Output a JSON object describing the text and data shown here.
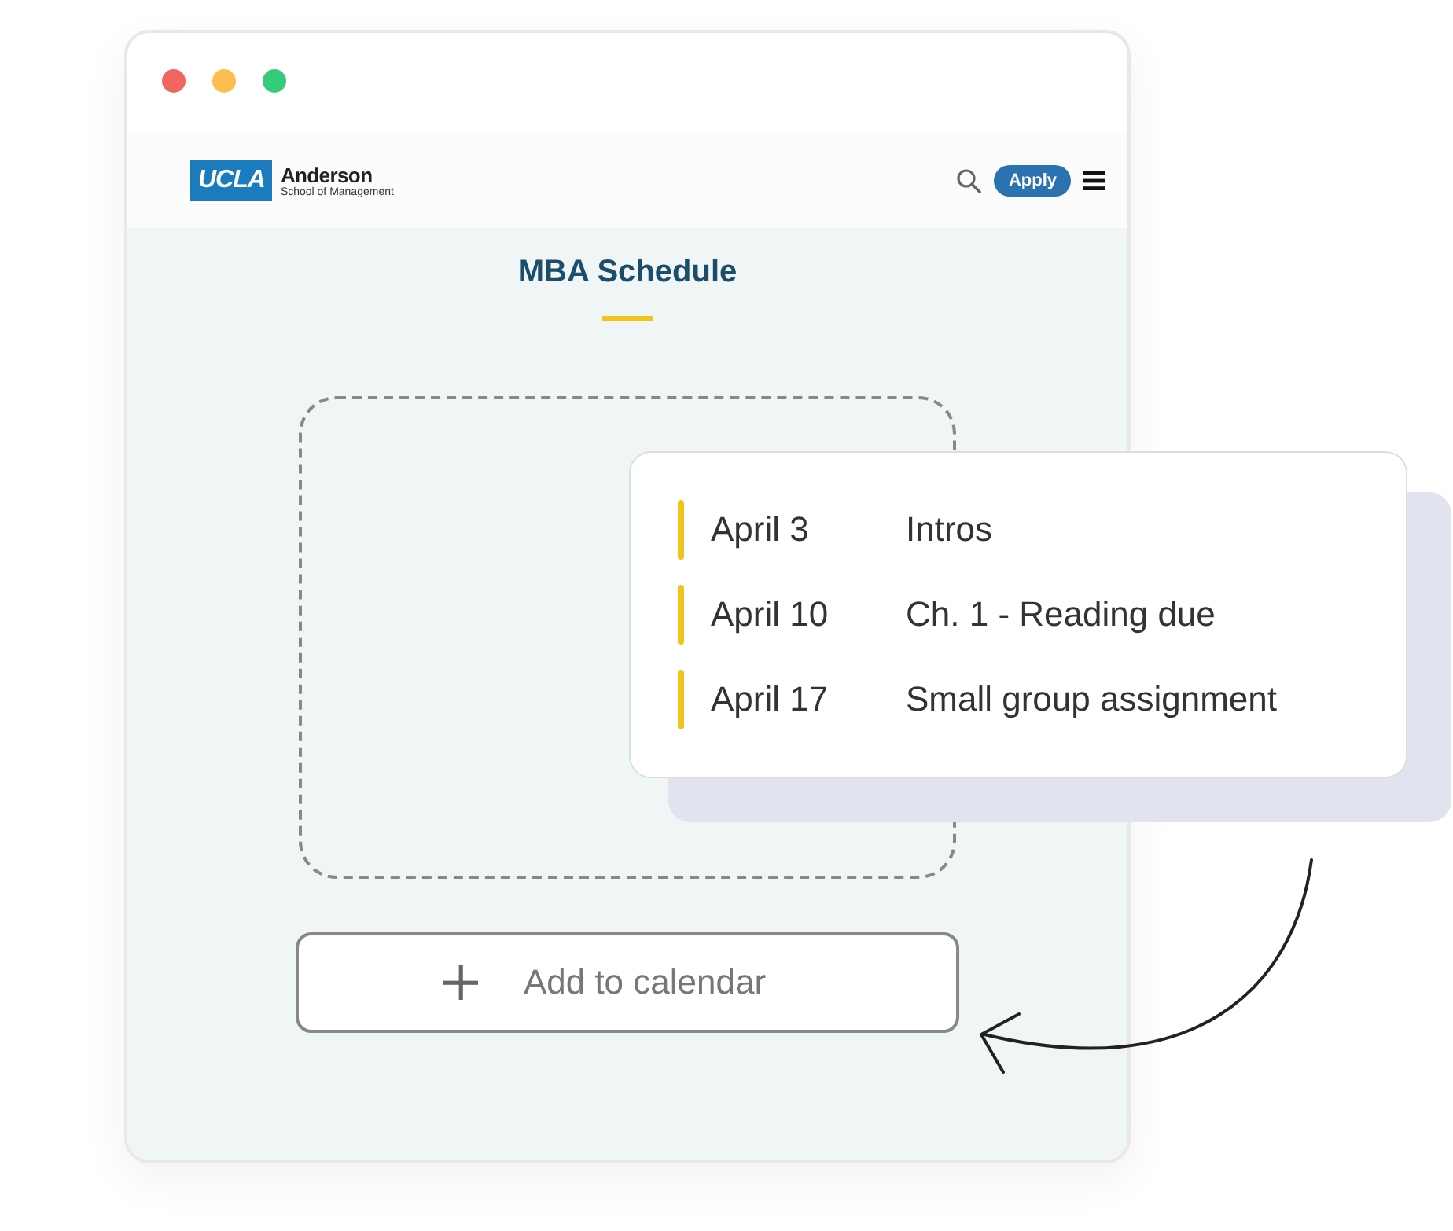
{
  "nav": {
    "logo_mark": "UCLA",
    "logo_name": "Anderson",
    "logo_subtitle": "School of Management",
    "apply_button": "Apply"
  },
  "title": "MBA Schedule",
  "events": [
    {
      "date": "April 3",
      "title": "Intros"
    },
    {
      "date": "April 10",
      "title": "Ch. 1 - Reading due"
    },
    {
      "date": "April 17",
      "title": "Small group assignment"
    }
  ],
  "add_button": {
    "label": "Add to calendar"
  }
}
